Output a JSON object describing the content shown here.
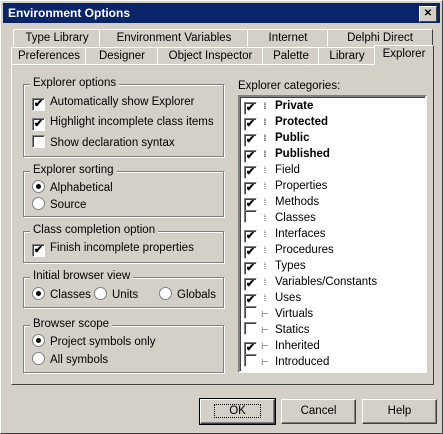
{
  "window": {
    "title": "Environment Options",
    "close_glyph": "✕"
  },
  "tabs_back": [
    {
      "label": "Type Library"
    },
    {
      "label": "Environment Variables"
    },
    {
      "label": "Internet"
    },
    {
      "label": "Delphi Direct"
    }
  ],
  "tabs_front": [
    {
      "label": "Preferences"
    },
    {
      "label": "Designer"
    },
    {
      "label": "Object Inspector"
    },
    {
      "label": "Palette"
    },
    {
      "label": "Library"
    },
    {
      "label": "Explorer"
    }
  ],
  "explorer_options": {
    "title": "Explorer options",
    "items": [
      {
        "label": "Automatically show Explorer",
        "checked": true
      },
      {
        "label": "Highlight incomplete class items",
        "checked": true
      },
      {
        "label": "Show declaration syntax",
        "checked": false
      }
    ]
  },
  "explorer_sorting": {
    "title": "Explorer sorting",
    "items": [
      {
        "label": "Alphabetical",
        "selected": true
      },
      {
        "label": "Source",
        "selected": false
      }
    ]
  },
  "class_completion": {
    "title": "Class completion option",
    "items": [
      {
        "label": "Finish incomplete properties",
        "checked": true
      }
    ]
  },
  "initial_browser_view": {
    "title": "Initial browser view",
    "items": [
      {
        "label": "Classes",
        "selected": true
      },
      {
        "label": "Units",
        "selected": false
      },
      {
        "label": "Globals",
        "selected": false
      }
    ]
  },
  "browser_scope": {
    "title": "Browser scope",
    "items": [
      {
        "label": "Project symbols only",
        "selected": true
      },
      {
        "label": "All symbols",
        "selected": false
      }
    ]
  },
  "categories": {
    "label": "Explorer categories:",
    "check_glyph": "✔",
    "items": [
      {
        "label": "Private",
        "checked": true,
        "bold": true,
        "icon": "member-icon"
      },
      {
        "label": "Protected",
        "checked": true,
        "bold": true,
        "icon": "member-icon"
      },
      {
        "label": "Public",
        "checked": true,
        "bold": true,
        "icon": "member-icon"
      },
      {
        "label": "Published",
        "checked": true,
        "bold": true,
        "icon": "member-icon"
      },
      {
        "label": "Field",
        "checked": true,
        "bold": false,
        "icon": "member-icon"
      },
      {
        "label": "Properties",
        "checked": true,
        "bold": false,
        "icon": "member-icon"
      },
      {
        "label": "Methods",
        "checked": true,
        "bold": false,
        "icon": "member-icon"
      },
      {
        "label": "Classes",
        "checked": false,
        "bold": false,
        "icon": "member-icon"
      },
      {
        "label": "Interfaces",
        "checked": true,
        "bold": false,
        "icon": "member-icon"
      },
      {
        "label": "Procedures",
        "checked": true,
        "bold": false,
        "icon": "member-icon"
      },
      {
        "label": "Types",
        "checked": true,
        "bold": false,
        "icon": "member-icon"
      },
      {
        "label": "Variables/Constants",
        "checked": true,
        "bold": false,
        "icon": "member-icon"
      },
      {
        "label": "Uses",
        "checked": true,
        "bold": false,
        "icon": "member-icon"
      },
      {
        "label": "Virtuals",
        "checked": false,
        "bold": false,
        "icon": "tree-icon"
      },
      {
        "label": "Statics",
        "checked": false,
        "bold": false,
        "icon": "tree-icon"
      },
      {
        "label": "Inherited",
        "checked": true,
        "bold": false,
        "icon": "tree-icon"
      },
      {
        "label": "Introduced",
        "checked": false,
        "bold": false,
        "icon": "tree-icon"
      }
    ]
  },
  "buttons": {
    "ok": "OK",
    "cancel": "Cancel",
    "help": "Help"
  },
  "colors": {
    "titlebar": "#0a246a",
    "face": "#d4d0c8"
  }
}
